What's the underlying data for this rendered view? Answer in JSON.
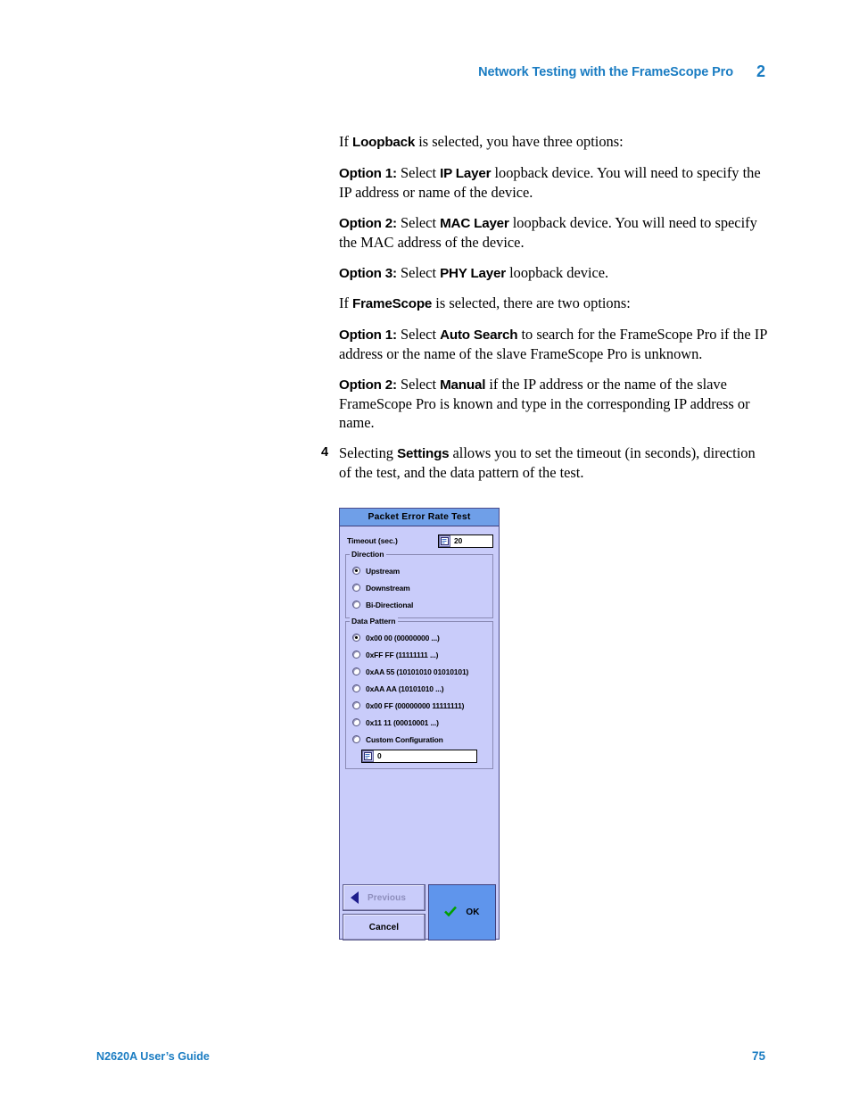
{
  "header": {
    "title": "Network Testing with the FrameScope Pro",
    "chapter": "2"
  },
  "body": {
    "p1_pre": "If ",
    "p1_bold": "Loopback",
    "p1_post": " is selected, you have three options:",
    "p2_label": "Option 1:",
    "p2_mid": " Select ",
    "p2_bold": "IP Layer",
    "p2_post": " loopback device. You will need to specify the IP address or name of the device.",
    "p3_label": "Option 2:",
    "p3_mid": " Select ",
    "p3_bold": "MAC Layer",
    "p3_post": " loopback device. You will need to specify the MAC address of the device.",
    "p4_label": "Option 3:",
    "p4_mid": " Select ",
    "p4_bold": "PHY Layer",
    "p4_post": " loopback device.",
    "p5_pre": "If ",
    "p5_bold": "FrameScope",
    "p5_post": " is selected, there are two options:",
    "p6_label": "Option 1:",
    "p6_mid": " Select ",
    "p6_bold": "Auto Search",
    "p6_post": " to search for the FrameScope Pro if the IP address or the name of the slave FrameScope Pro is unknown.",
    "p7_label": "Option 2:",
    "p7_mid": " Select ",
    "p7_bold": "Manual",
    "p7_post": " if the IP address or the name of the slave FrameScope Pro is known and type in the corresponding IP address or name.",
    "step4_num": "4",
    "step4_pre": "Selecting ",
    "step4_bold": "Settings",
    "step4_post": " allows you to set the timeout (in seconds), direction of the test, and the data pattern of the test."
  },
  "dialog": {
    "title": "Packet Error Rate Test",
    "timeout_label": "Timeout (sec.)",
    "timeout_value": "20",
    "direction": {
      "legend": "Direction",
      "options": [
        {
          "label": "Upstream",
          "selected": true
        },
        {
          "label": "Downstream",
          "selected": false
        },
        {
          "label": "Bi-Directional",
          "selected": false
        }
      ]
    },
    "data_pattern": {
      "legend": "Data Pattern",
      "options": [
        {
          "label": "0x00 00 (00000000 ...)",
          "selected": true
        },
        {
          "label": "0xFF FF (11111111 ...)",
          "selected": false
        },
        {
          "label": "0xAA 55 (10101010 01010101)",
          "selected": false
        },
        {
          "label": "0xAA AA (10101010 ...)",
          "selected": false
        },
        {
          "label": "0x00 FF (00000000 11111111)",
          "selected": false
        },
        {
          "label": "0x11 11 (00010001 ...)",
          "selected": false
        },
        {
          "label": "Custom Configuration",
          "selected": false
        }
      ],
      "custom_value": "0"
    },
    "buttons": {
      "previous": "Previous",
      "cancel": "Cancel",
      "ok": "OK"
    },
    "colors": {
      "titlebar": "#6f9fe8",
      "body": "#c9ccfa",
      "ok_button": "#5f95ec",
      "check": "#00a000"
    }
  },
  "footer": {
    "guide": "N2620A User’s Guide",
    "page": "75"
  },
  "theme": {
    "accent_blue": "#1a7cc2"
  }
}
